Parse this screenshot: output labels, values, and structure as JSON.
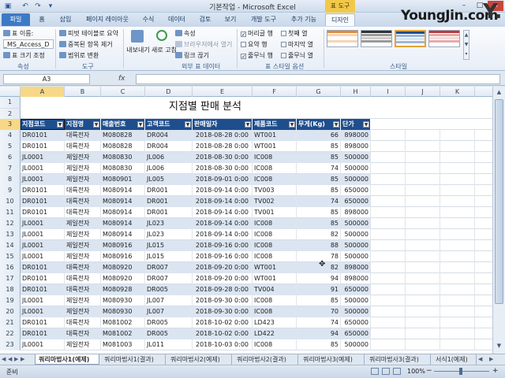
{
  "titlebar": {
    "title": "기본작업 - Microsoft Excel",
    "context_tab": "표 도구"
  },
  "qat": [
    "▣",
    "↶",
    "↷",
    "▾"
  ],
  "tabs": [
    "파일",
    "홈",
    "삽입",
    "페이지 레이아웃",
    "수식",
    "데이터",
    "검토",
    "보기",
    "개발 도구",
    "추가 기능",
    "디자인"
  ],
  "brand": "YoungJin.com",
  "brand_mark": "Y.",
  "ribbon": {
    "properties": {
      "label_name": "표 이름:",
      "name_value": "_MS_Access_D",
      "resize": "표 크기 조정",
      "group": "속성"
    },
    "tools": {
      "pivot": "피벗 테이블로 요약",
      "dedupe": "중복된 항목 제거",
      "convert": "범위로 변환",
      "group": "도구"
    },
    "external": {
      "export": "내보내기",
      "refresh": "새로 고침",
      "props": "속성",
      "open_browser": "브라우저에서 열기",
      "unlink": "링크 끊기",
      "group": "외부 표 데이터"
    },
    "style_options": {
      "header_row": "머리글 행",
      "total_row": "요약 행",
      "banded_rows": "줄무늬 행",
      "first_col": "첫째 열",
      "last_col": "마지막 열",
      "banded_cols": "줄무늬 열",
      "group": "표 스타일 옵션"
    },
    "styles": {
      "group": "스타일"
    }
  },
  "formula": {
    "name_box": "A3",
    "fx": "fx",
    "value": ""
  },
  "columns": [
    "A",
    "B",
    "C",
    "D",
    "E",
    "F",
    "G",
    "H",
    "I",
    "J",
    "K"
  ],
  "sheet_title": "지점별 판매 분석",
  "headers": [
    "지점코드",
    "지점명",
    "매출번호",
    "고객코드",
    "판매일자",
    "제품코드",
    "무게(Kg)",
    "단가"
  ],
  "rows": [
    [
      "DR0101",
      "대륙전자",
      "M080828",
      "DR004",
      "2018-08-28 0:00",
      "WT001",
      "66",
      "898000"
    ],
    [
      "DR0101",
      "대륙전자",
      "M080828",
      "DR004",
      "2018-08-28 0:00",
      "WT001",
      "85",
      "898000"
    ],
    [
      "JL0001",
      "제일전자",
      "M080830",
      "JL006",
      "2018-08-30 0:00",
      "IC008",
      "85",
      "500000"
    ],
    [
      "JL0001",
      "제일전자",
      "M080830",
      "JL006",
      "2018-08-30 0:00",
      "IC008",
      "74",
      "500000"
    ],
    [
      "JL0001",
      "제일전자",
      "M080901",
      "JL005",
      "2018-09-01 0:00",
      "IC008",
      "85",
      "500000"
    ],
    [
      "DR0101",
      "대륙전자",
      "M080914",
      "DR001",
      "2018-09-14 0:00",
      "TV003",
      "85",
      "650000"
    ],
    [
      "DR0101",
      "대륙전자",
      "M080914",
      "DR001",
      "2018-09-14 0:00",
      "TV002",
      "74",
      "650000"
    ],
    [
      "DR0101",
      "대륙전자",
      "M080914",
      "DR001",
      "2018-09-14 0:00",
      "TV001",
      "85",
      "898000"
    ],
    [
      "JL0001",
      "제일전자",
      "M080914",
      "JL023",
      "2018-09-14 0:00",
      "IC008",
      "85",
      "500000"
    ],
    [
      "JL0001",
      "제일전자",
      "M080914",
      "JL023",
      "2018-09-14 0:00",
      "IC008",
      "82",
      "500000"
    ],
    [
      "JL0001",
      "제일전자",
      "M080916",
      "JL015",
      "2018-09-16 0:00",
      "IC008",
      "88",
      "500000"
    ],
    [
      "JL0001",
      "제일전자",
      "M080916",
      "JL015",
      "2018-09-16 0:00",
      "IC008",
      "78",
      "500000"
    ],
    [
      "DR0101",
      "대륙전자",
      "M080920",
      "DR007",
      "2018-09-20 0:00",
      "WT001",
      "82",
      "898000"
    ],
    [
      "DR0101",
      "대륙전자",
      "M080920",
      "DR007",
      "2018-09-20 0:00",
      "WT001",
      "94",
      "898000"
    ],
    [
      "DR0101",
      "대륙전자",
      "M080928",
      "DR005",
      "2018-09-28 0:00",
      "TV004",
      "91",
      "650000"
    ],
    [
      "JL0001",
      "제일전자",
      "M080930",
      "JL007",
      "2018-09-30 0:00",
      "IC008",
      "85",
      "500000"
    ],
    [
      "JL0001",
      "제일전자",
      "M080930",
      "JL007",
      "2018-09-30 0:00",
      "IC008",
      "70",
      "500000"
    ],
    [
      "DR0101",
      "대륙전자",
      "M081002",
      "DR005",
      "2018-10-02 0:00",
      "LD423",
      "74",
      "650000"
    ],
    [
      "DR0101",
      "대륙전자",
      "M081002",
      "DR005",
      "2018-10-02 0:00",
      "LD422",
      "94",
      "650000"
    ],
    [
      "JL0001",
      "제일전자",
      "M081003",
      "JL011",
      "2018-10-03 0:00",
      "IC008",
      "85",
      "500000"
    ]
  ],
  "sheet_tabs": [
    "쿼리마법사1(예제)",
    "쿼리마법사1(결과)",
    "쿼리마법사2(예제)",
    "쿼리마법사2(결과)",
    "쿼리마법사3(예제)",
    "쿼리마법사3(결과)",
    "서식1(예제)"
  ],
  "status": {
    "ready": "준비",
    "zoom": "100%"
  },
  "colors": {
    "header_fill": "#1f4e8c",
    "band_fill": "#dbe5f1",
    "selected_header": "#f7d886",
    "file_tab": "#3d7ac6"
  }
}
